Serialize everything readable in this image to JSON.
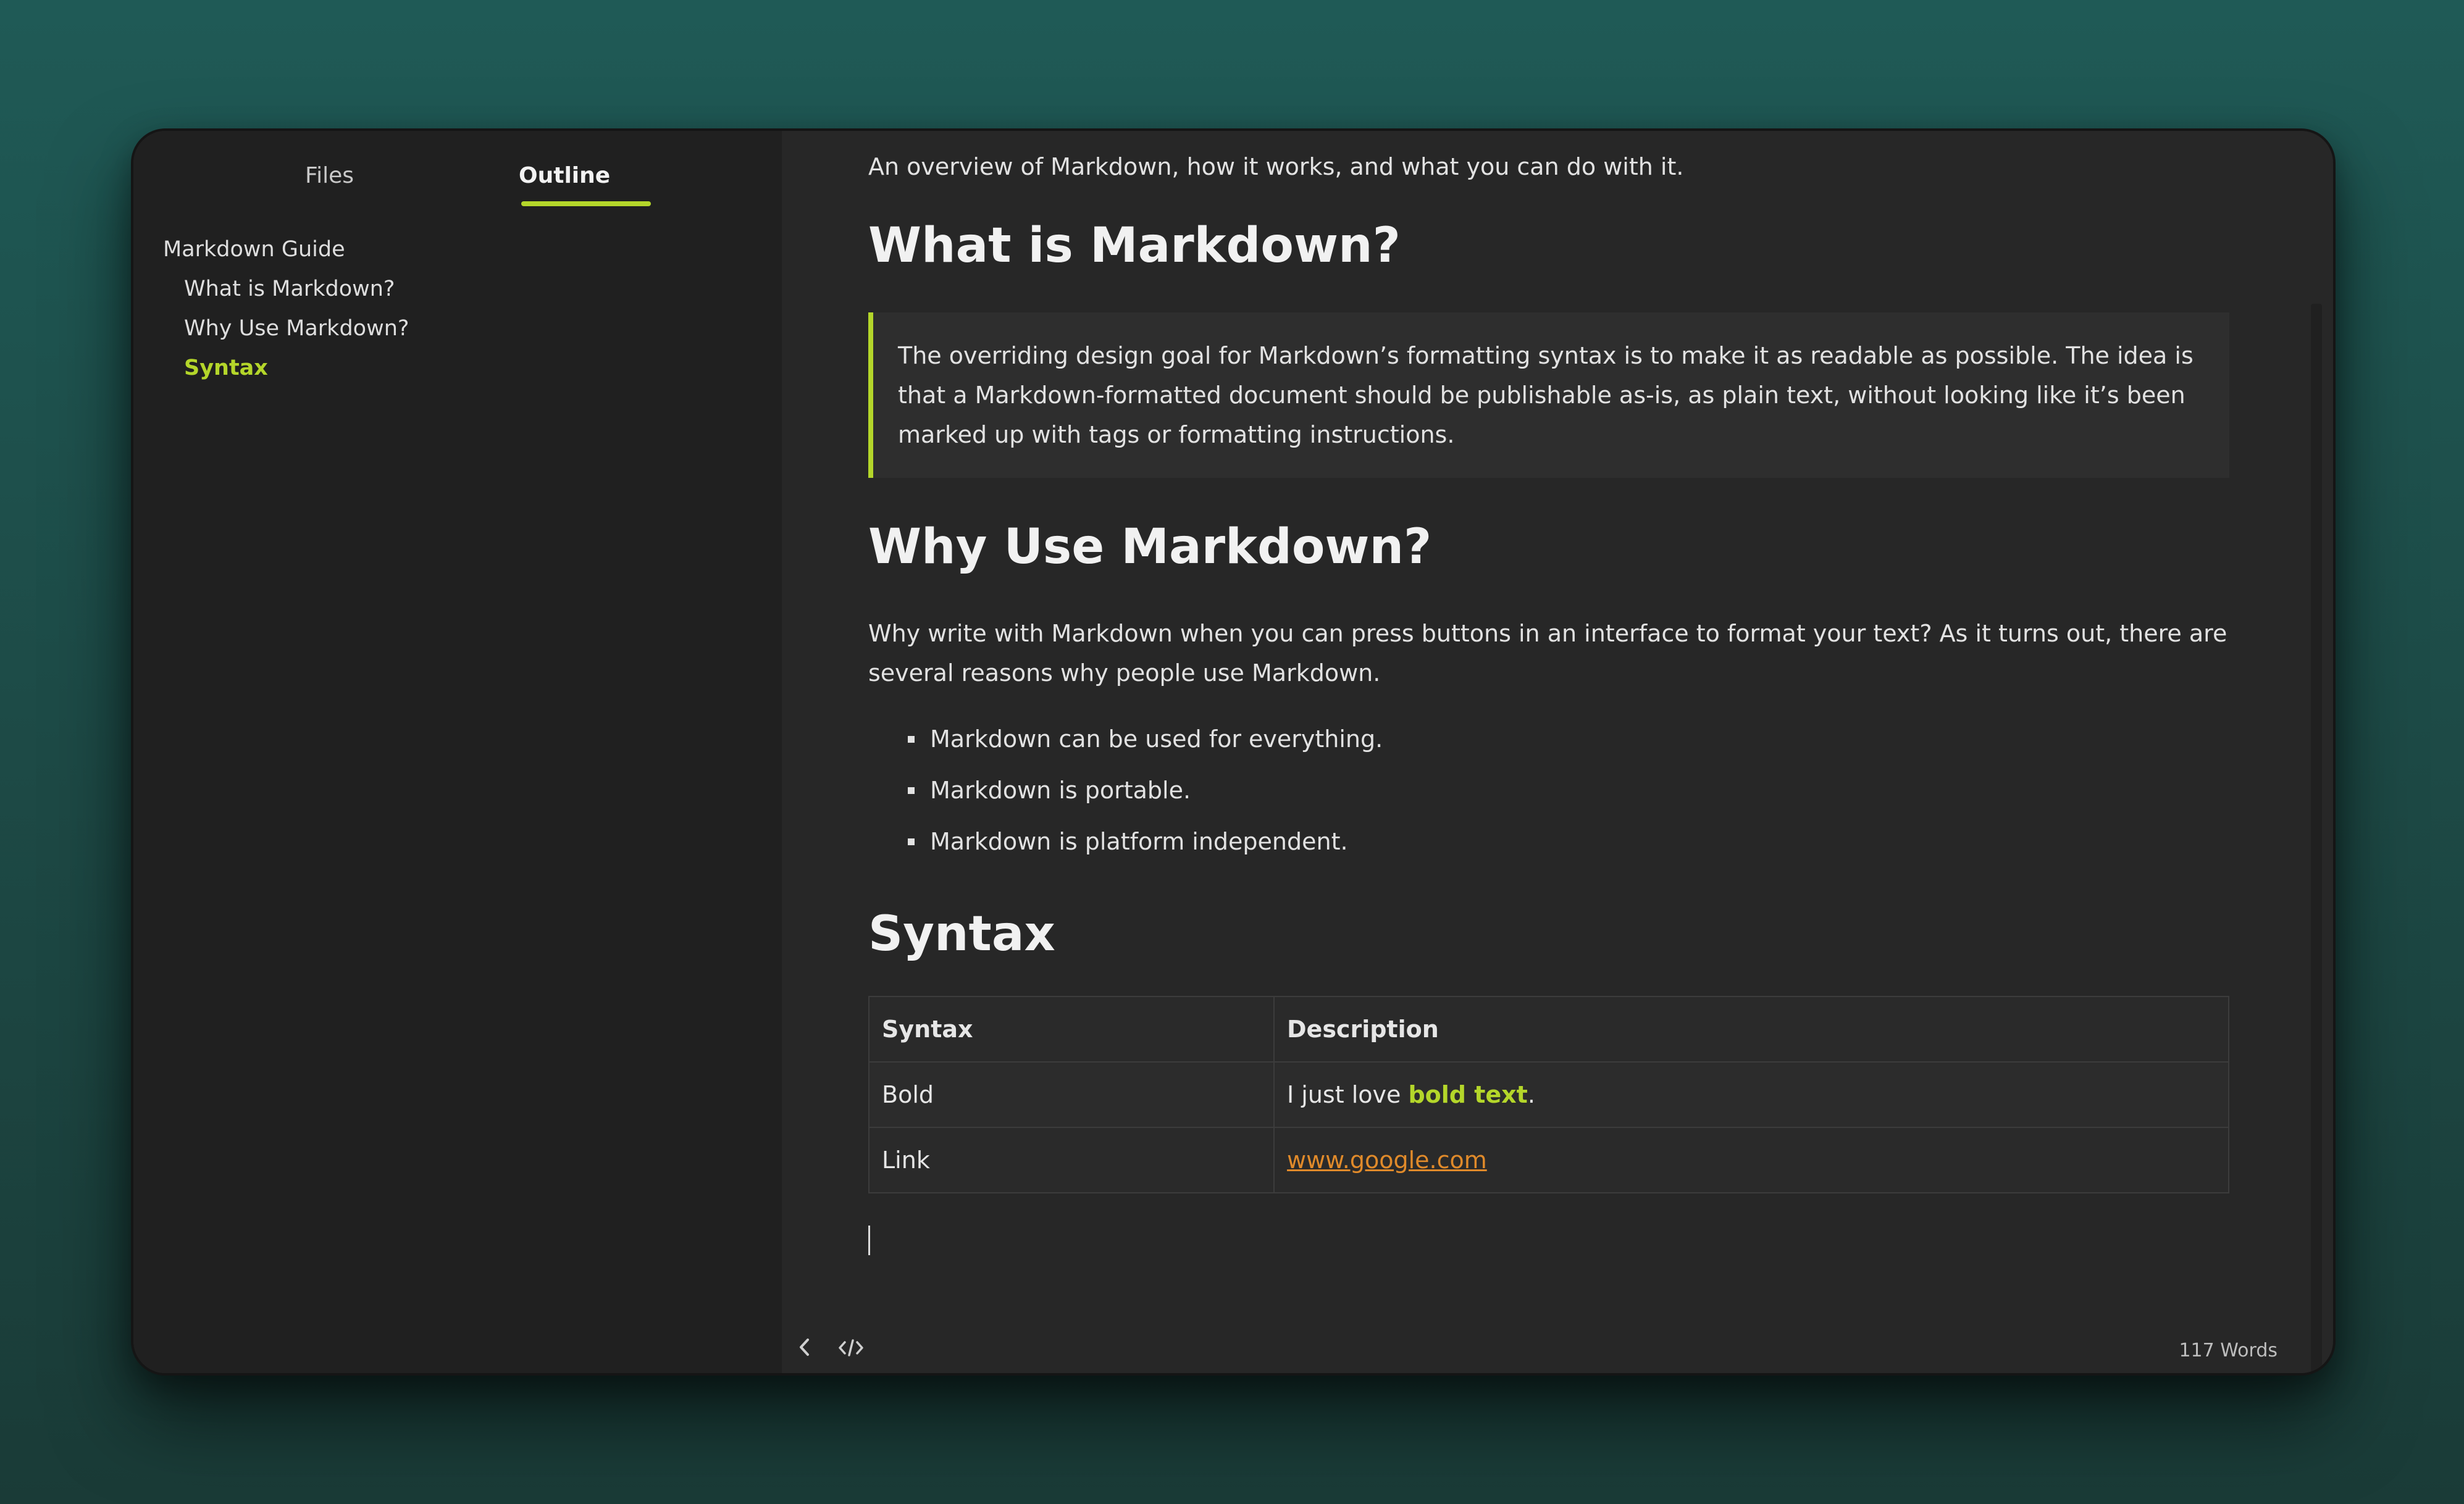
{
  "sidebar": {
    "tabs": {
      "files": "Files",
      "outline": "Outline"
    },
    "outline": [
      {
        "label": "Markdown Guide",
        "level": 1,
        "active": false
      },
      {
        "label": "What is Markdown?",
        "level": 2,
        "active": false
      },
      {
        "label": "Why Use Markdown?",
        "level": 2,
        "active": false
      },
      {
        "label": "Syntax",
        "level": 2,
        "active": true
      }
    ]
  },
  "document": {
    "intro": "An overview of Markdown, how it works, and what you can do with it.",
    "h_what": "What is Markdown?",
    "quote": "The overriding design goal for Markdown’s formatting syntax is to make it as readable as possible. The idea is that a Markdown-formatted document should be publishable as-is, as plain text, without looking like it’s been marked up with tags or formatting instructions.",
    "h_why": "Why Use Markdown?",
    "why_para": "Why write with Markdown when you can press buttons in an interface to format your text? As it turns out, there are several reasons why people use Markdown.",
    "bullets": [
      "Markdown can be used for everything.",
      "Markdown is portable.",
      "Markdown is platform independent."
    ],
    "h_syntax": "Syntax",
    "table": {
      "headers": [
        "Syntax",
        "Description"
      ],
      "row1_col1": "Bold",
      "row1_prefix": "I just love ",
      "row1_bold": "bold text",
      "row1_suffix": ".",
      "row2_col1": "Link",
      "row2_link": "www.google.com"
    }
  },
  "footer": {
    "back_icon": "chevron-left-icon",
    "code_icon": "code-icon",
    "word_count": "117 Words"
  },
  "colors": {
    "accent": "#b4d62a",
    "link": "#e08a2a",
    "background": "#1f5a56"
  }
}
